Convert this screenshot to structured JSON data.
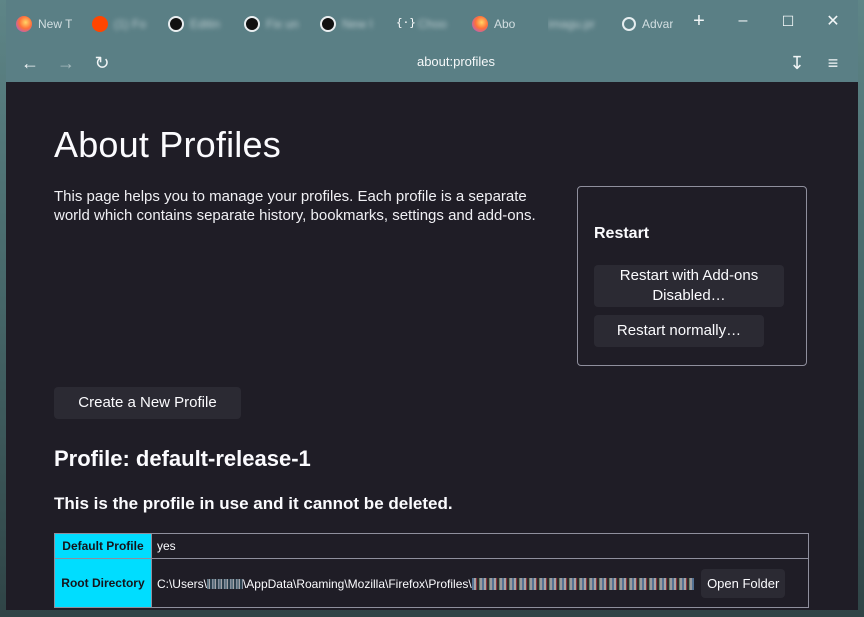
{
  "tabs": [
    {
      "label": "New T",
      "icon": "firefox-icon",
      "active": false
    },
    {
      "label": "(1) Fo",
      "icon": "reddit-icon",
      "active": false
    },
    {
      "label": "Editin",
      "icon": "github-icon",
      "active": false
    },
    {
      "label": "Fix un",
      "icon": "github-icon",
      "active": false
    },
    {
      "label": "New I",
      "icon": "github-icon",
      "active": false
    },
    {
      "label": "Choo",
      "icon": "code-icon",
      "active": false
    },
    {
      "label": "Abo",
      "icon": "firefox-icon",
      "active": true
    },
    {
      "label": "imagu.pr",
      "icon": "blank-icon",
      "active": false
    },
    {
      "label": "Advar",
      "icon": "gear-icon",
      "active": false
    }
  ],
  "toolbar": {
    "url": "about:profiles"
  },
  "page": {
    "title": "About Profiles",
    "intro": "This page helps you to manage your profiles. Each profile is a separate world which contains separate history, bookmarks, settings and add-ons.",
    "restart": {
      "heading": "Restart",
      "addons_disabled_label": "Restart with Add-ons Disabled…",
      "normally_label": "Restart normally…"
    },
    "create_profile_label": "Create a New Profile",
    "profile": {
      "title": "Profile: default-release-1",
      "note": "This is the profile in use and it cannot be deleted.",
      "rows": {
        "default_label": "Default Profile",
        "default_value": "yes",
        "root_label": "Root Directory",
        "root_prefix": "C:\\Users\\",
        "root_middle": "\\AppData\\Roaming\\Mozilla\\Firefox\\Profiles\\",
        "open_folder_label": "Open Folder"
      }
    }
  },
  "colors": {
    "chrome": "#5a7f85",
    "page_bg": "#1f1d26",
    "button_bg": "#2b2a33",
    "table_header": "#00ddff"
  }
}
